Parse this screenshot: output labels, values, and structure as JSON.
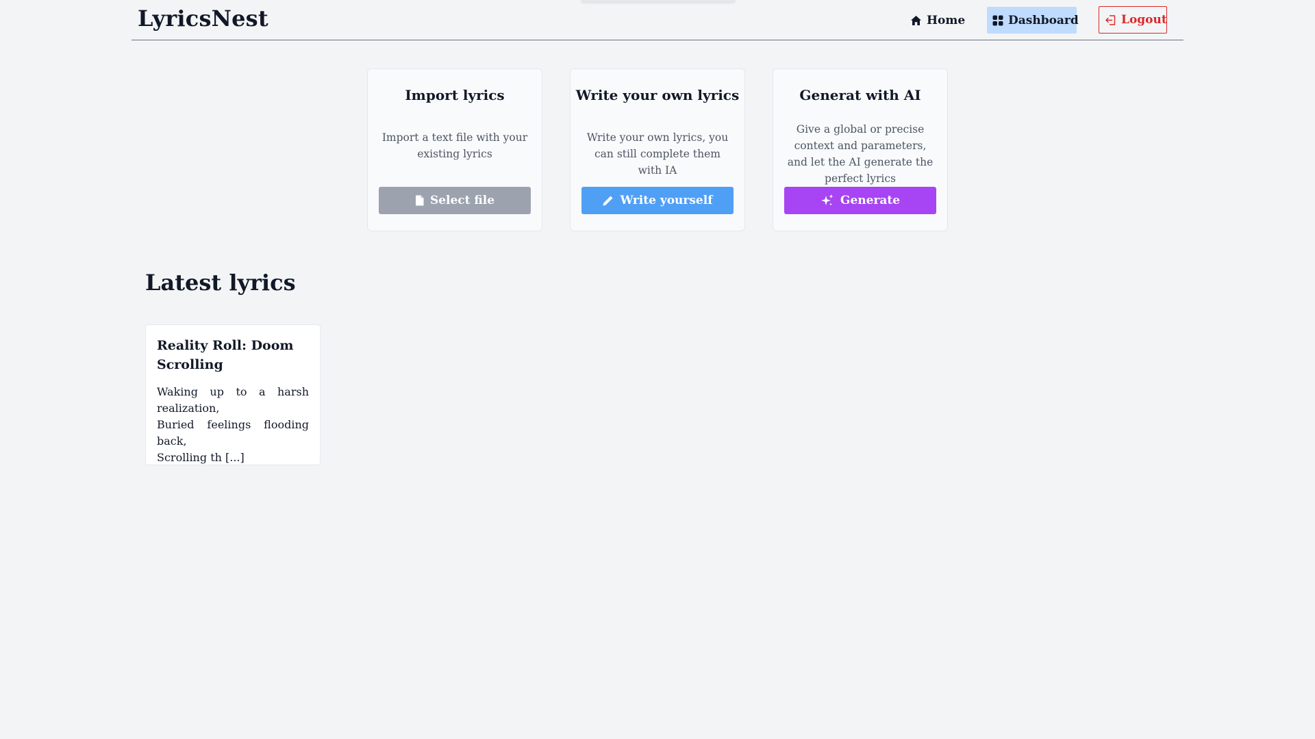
{
  "app": {
    "logo": "LyricsNest"
  },
  "nav": {
    "home": "Home",
    "dashboard": "Dashboard",
    "logout": "Logout"
  },
  "actions": [
    {
      "title": "Import lyrics",
      "description": "Import a text file with your existing lyrics",
      "button": "Select file",
      "icon": "file-icon",
      "color": "#9ca3af"
    },
    {
      "title": "Write your own lyrics",
      "description": "Write your own lyrics, you can still complete them with IA",
      "button": "Write yourself",
      "icon": "pencil-icon",
      "color": "#4f9ff5"
    },
    {
      "title": "Generat with AI",
      "description": "Give a global or precise context and parameters, and let the AI generate the perfect lyrics",
      "button": "Generate",
      "icon": "sparkles-icon",
      "color": "#a744f3"
    }
  ],
  "latest": {
    "heading": "Latest lyrics",
    "items": [
      {
        "title": "Reality Roll: Doom Scrolling",
        "excerpt": "Waking up to a harsh realization,\nBuried feelings flooding back,\nScrolling th [...]"
      }
    ]
  },
  "colors": {
    "background": "#f3f4f6",
    "dashboard_active": "#bfdbfe",
    "logout": "#dc2626"
  }
}
